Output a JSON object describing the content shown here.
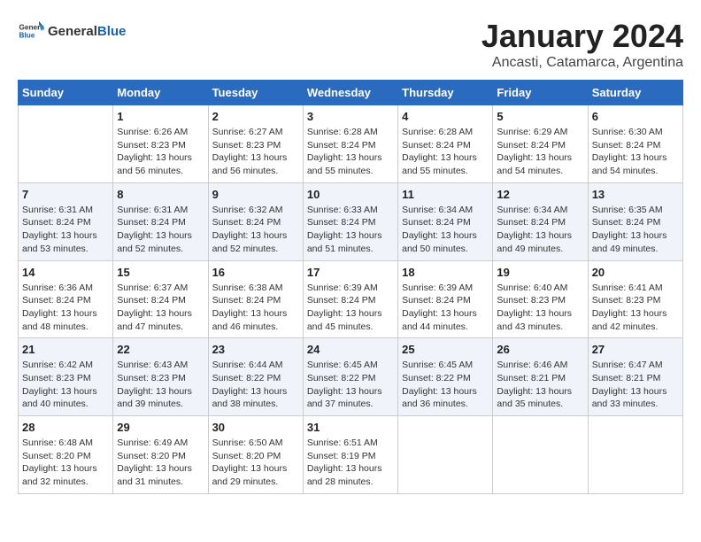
{
  "header": {
    "logo_general": "General",
    "logo_blue": "Blue",
    "month_title": "January 2024",
    "location": "Ancasti, Catamarca, Argentina"
  },
  "calendar": {
    "weekdays": [
      "Sunday",
      "Monday",
      "Tuesday",
      "Wednesday",
      "Thursday",
      "Friday",
      "Saturday"
    ],
    "weeks": [
      [
        {
          "day": "",
          "sunrise": "",
          "sunset": "",
          "daylight": ""
        },
        {
          "day": "1",
          "sunrise": "Sunrise: 6:26 AM",
          "sunset": "Sunset: 8:23 PM",
          "daylight": "Daylight: 13 hours and 56 minutes."
        },
        {
          "day": "2",
          "sunrise": "Sunrise: 6:27 AM",
          "sunset": "Sunset: 8:23 PM",
          "daylight": "Daylight: 13 hours and 56 minutes."
        },
        {
          "day": "3",
          "sunrise": "Sunrise: 6:28 AM",
          "sunset": "Sunset: 8:24 PM",
          "daylight": "Daylight: 13 hours and 55 minutes."
        },
        {
          "day": "4",
          "sunrise": "Sunrise: 6:28 AM",
          "sunset": "Sunset: 8:24 PM",
          "daylight": "Daylight: 13 hours and 55 minutes."
        },
        {
          "day": "5",
          "sunrise": "Sunrise: 6:29 AM",
          "sunset": "Sunset: 8:24 PM",
          "daylight": "Daylight: 13 hours and 54 minutes."
        },
        {
          "day": "6",
          "sunrise": "Sunrise: 6:30 AM",
          "sunset": "Sunset: 8:24 PM",
          "daylight": "Daylight: 13 hours and 54 minutes."
        }
      ],
      [
        {
          "day": "7",
          "sunrise": "Sunrise: 6:31 AM",
          "sunset": "Sunset: 8:24 PM",
          "daylight": "Daylight: 13 hours and 53 minutes."
        },
        {
          "day": "8",
          "sunrise": "Sunrise: 6:31 AM",
          "sunset": "Sunset: 8:24 PM",
          "daylight": "Daylight: 13 hours and 52 minutes."
        },
        {
          "day": "9",
          "sunrise": "Sunrise: 6:32 AM",
          "sunset": "Sunset: 8:24 PM",
          "daylight": "Daylight: 13 hours and 52 minutes."
        },
        {
          "day": "10",
          "sunrise": "Sunrise: 6:33 AM",
          "sunset": "Sunset: 8:24 PM",
          "daylight": "Daylight: 13 hours and 51 minutes."
        },
        {
          "day": "11",
          "sunrise": "Sunrise: 6:34 AM",
          "sunset": "Sunset: 8:24 PM",
          "daylight": "Daylight: 13 hours and 50 minutes."
        },
        {
          "day": "12",
          "sunrise": "Sunrise: 6:34 AM",
          "sunset": "Sunset: 8:24 PM",
          "daylight": "Daylight: 13 hours and 49 minutes."
        },
        {
          "day": "13",
          "sunrise": "Sunrise: 6:35 AM",
          "sunset": "Sunset: 8:24 PM",
          "daylight": "Daylight: 13 hours and 49 minutes."
        }
      ],
      [
        {
          "day": "14",
          "sunrise": "Sunrise: 6:36 AM",
          "sunset": "Sunset: 8:24 PM",
          "daylight": "Daylight: 13 hours and 48 minutes."
        },
        {
          "day": "15",
          "sunrise": "Sunrise: 6:37 AM",
          "sunset": "Sunset: 8:24 PM",
          "daylight": "Daylight: 13 hours and 47 minutes."
        },
        {
          "day": "16",
          "sunrise": "Sunrise: 6:38 AM",
          "sunset": "Sunset: 8:24 PM",
          "daylight": "Daylight: 13 hours and 46 minutes."
        },
        {
          "day": "17",
          "sunrise": "Sunrise: 6:39 AM",
          "sunset": "Sunset: 8:24 PM",
          "daylight": "Daylight: 13 hours and 45 minutes."
        },
        {
          "day": "18",
          "sunrise": "Sunrise: 6:39 AM",
          "sunset": "Sunset: 8:24 PM",
          "daylight": "Daylight: 13 hours and 44 minutes."
        },
        {
          "day": "19",
          "sunrise": "Sunrise: 6:40 AM",
          "sunset": "Sunset: 8:23 PM",
          "daylight": "Daylight: 13 hours and 43 minutes."
        },
        {
          "day": "20",
          "sunrise": "Sunrise: 6:41 AM",
          "sunset": "Sunset: 8:23 PM",
          "daylight": "Daylight: 13 hours and 42 minutes."
        }
      ],
      [
        {
          "day": "21",
          "sunrise": "Sunrise: 6:42 AM",
          "sunset": "Sunset: 8:23 PM",
          "daylight": "Daylight: 13 hours and 40 minutes."
        },
        {
          "day": "22",
          "sunrise": "Sunrise: 6:43 AM",
          "sunset": "Sunset: 8:23 PM",
          "daylight": "Daylight: 13 hours and 39 minutes."
        },
        {
          "day": "23",
          "sunrise": "Sunrise: 6:44 AM",
          "sunset": "Sunset: 8:22 PM",
          "daylight": "Daylight: 13 hours and 38 minutes."
        },
        {
          "day": "24",
          "sunrise": "Sunrise: 6:45 AM",
          "sunset": "Sunset: 8:22 PM",
          "daylight": "Daylight: 13 hours and 37 minutes."
        },
        {
          "day": "25",
          "sunrise": "Sunrise: 6:45 AM",
          "sunset": "Sunset: 8:22 PM",
          "daylight": "Daylight: 13 hours and 36 minutes."
        },
        {
          "day": "26",
          "sunrise": "Sunrise: 6:46 AM",
          "sunset": "Sunset: 8:21 PM",
          "daylight": "Daylight: 13 hours and 35 minutes."
        },
        {
          "day": "27",
          "sunrise": "Sunrise: 6:47 AM",
          "sunset": "Sunset: 8:21 PM",
          "daylight": "Daylight: 13 hours and 33 minutes."
        }
      ],
      [
        {
          "day": "28",
          "sunrise": "Sunrise: 6:48 AM",
          "sunset": "Sunset: 8:20 PM",
          "daylight": "Daylight: 13 hours and 32 minutes."
        },
        {
          "day": "29",
          "sunrise": "Sunrise: 6:49 AM",
          "sunset": "Sunset: 8:20 PM",
          "daylight": "Daylight: 13 hours and 31 minutes."
        },
        {
          "day": "30",
          "sunrise": "Sunrise: 6:50 AM",
          "sunset": "Sunset: 8:20 PM",
          "daylight": "Daylight: 13 hours and 29 minutes."
        },
        {
          "day": "31",
          "sunrise": "Sunrise: 6:51 AM",
          "sunset": "Sunset: 8:19 PM",
          "daylight": "Daylight: 13 hours and 28 minutes."
        },
        {
          "day": "",
          "sunrise": "",
          "sunset": "",
          "daylight": ""
        },
        {
          "day": "",
          "sunrise": "",
          "sunset": "",
          "daylight": ""
        },
        {
          "day": "",
          "sunrise": "",
          "sunset": "",
          "daylight": ""
        }
      ]
    ]
  }
}
